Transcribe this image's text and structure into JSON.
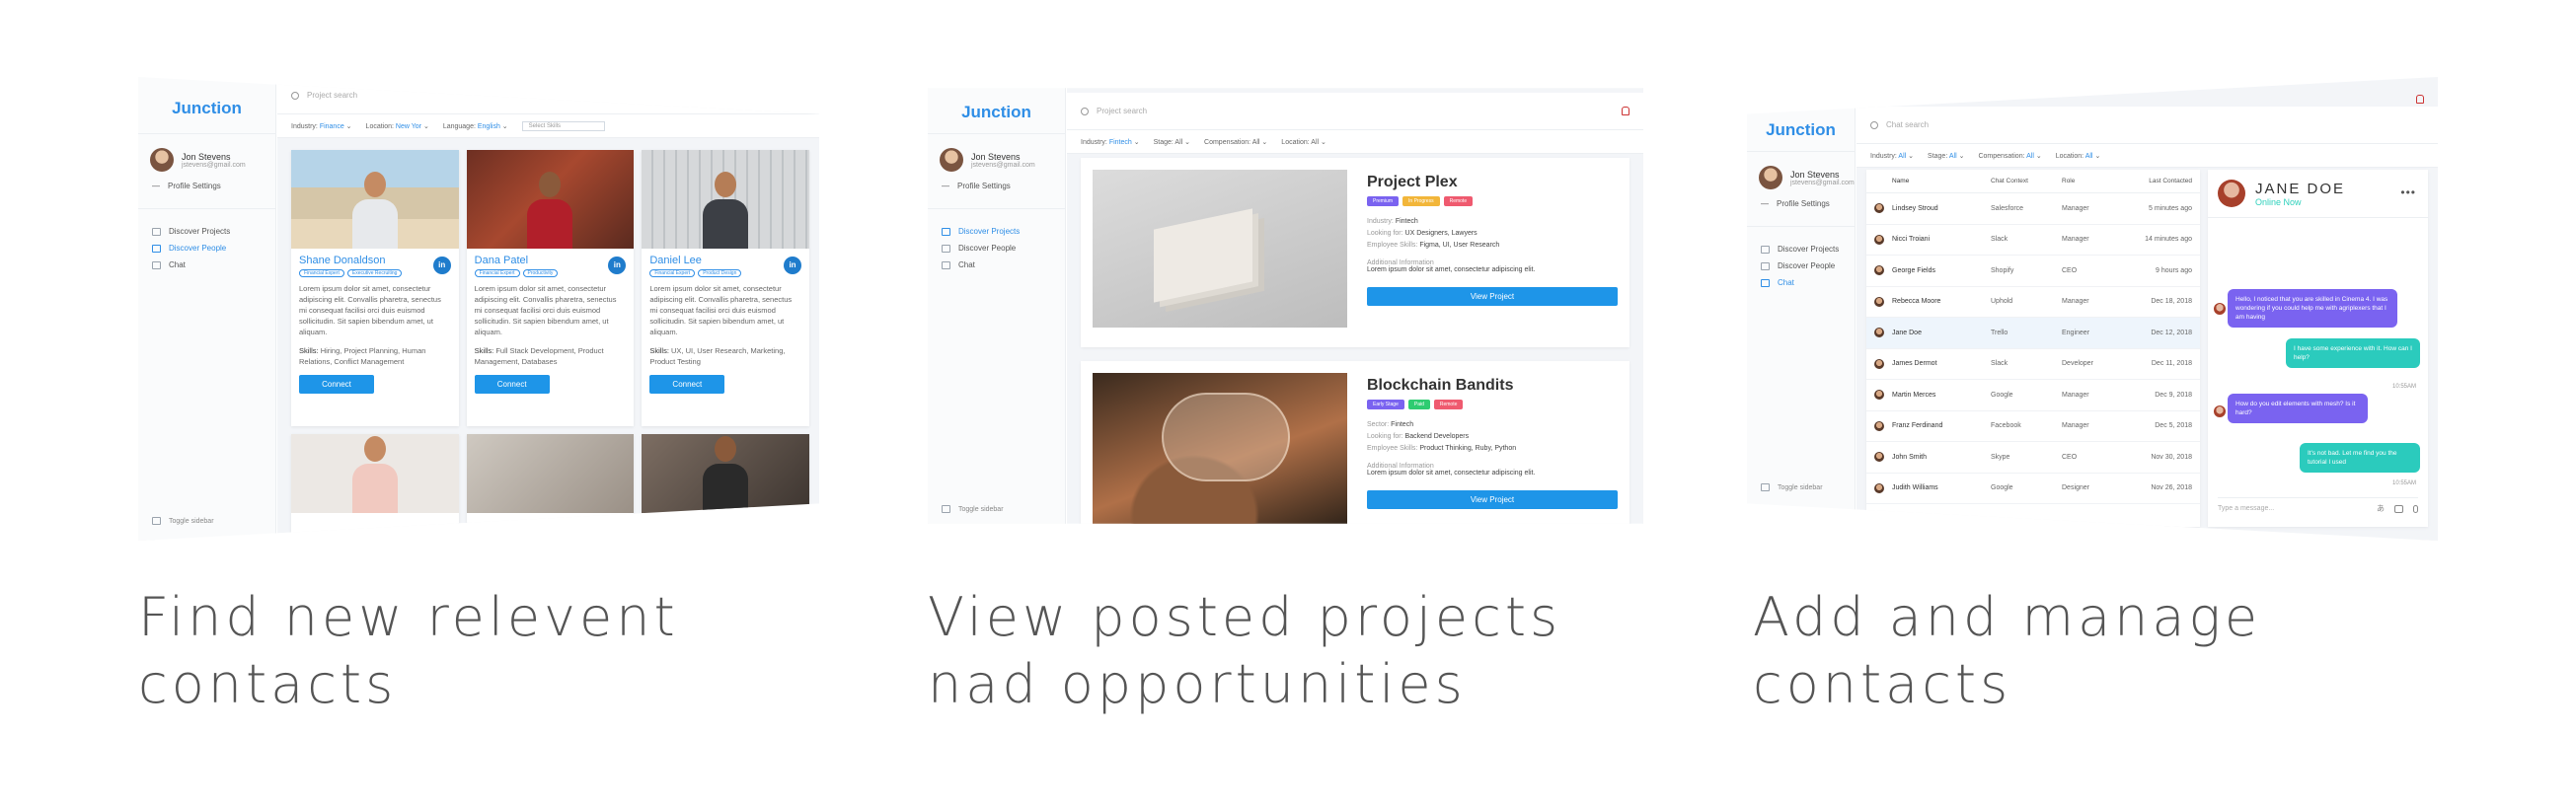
{
  "app": {
    "logo": "Junction"
  },
  "user": {
    "name": "Jon Stevens",
    "email": "jstevens@gmail.com"
  },
  "sidebar": {
    "profile_settings": "Profile Settings",
    "items": [
      "Discover Projects",
      "Discover People",
      "Chat"
    ],
    "toggle": "Toggle sidebar"
  },
  "search": {
    "placeholder": "Project search",
    "placeholder_chat": "Chat search"
  },
  "people_screen": {
    "filters": [
      {
        "label": "Industry:",
        "value": "Finance"
      },
      {
        "label": "Location:",
        "value": "New Yor"
      },
      {
        "label": "Language:",
        "value": "English"
      }
    ],
    "skills_select": "Select Skills",
    "cards": [
      {
        "name": "Shane Donaldson",
        "tags": [
          "Financial Expert",
          "Executive Recruiting"
        ],
        "bio": "Lorem ipsum dolor sit amet, consectetur adipiscing elit. Convallis pharetra, senectus mi consequat facilisi orci duis euismod sollicitudin. Sit sapien bibendum amet, ut aliquam.",
        "skills_label": "Skills:",
        "skills": "Hiring, Project Planning, Human Relations, Conflict Management",
        "button": "Connect",
        "linkedin": "in"
      },
      {
        "name": "Dana Patel",
        "tags": [
          "Financial Expert",
          "Productivity"
        ],
        "bio": "Lorem ipsum dolor sit amet, consectetur adipiscing elit. Convallis pharetra, senectus mi consequat facilisi orci duis euismod sollicitudin. Sit sapien bibendum amet, ut aliquam.",
        "skills_label": "Skills:",
        "skills": "Full Stack Development, Product Management, Databases",
        "button": "Connect",
        "linkedin": "in"
      },
      {
        "name": "Daniel Lee",
        "tags": [
          "Financial Expert",
          "Product Design"
        ],
        "bio": "Lorem ipsum dolor sit amet, consectetur adipiscing elit. Convallis pharetra, senectus mi consequat facilisi orci duis euismod sollicitudin. Sit sapien bibendum amet, ut aliquam.",
        "skills_label": "Skills:",
        "skills": "UX, UI, User Research, Marketing, Product Testing",
        "button": "Connect",
        "linkedin": "in"
      }
    ]
  },
  "projects_screen": {
    "filters": [
      {
        "label": "Industry:",
        "value": "Fintech"
      },
      {
        "label": "Stage:",
        "value": "All"
      },
      {
        "label": "Compensation:",
        "value": "All"
      },
      {
        "label": "Location:",
        "value": "All"
      }
    ],
    "projects": [
      {
        "title": "Project Plex",
        "tags": [
          {
            "text": "Premium",
            "color": "#7a63f0"
          },
          {
            "text": "In Progress",
            "color": "#f2b63a"
          },
          {
            "text": "Remote",
            "color": "#ef5a6f"
          }
        ],
        "meta": [
          {
            "label": "Industry:",
            "value": "Fintech"
          },
          {
            "label": "Looking for:",
            "value": "UX Designers, Lawyers"
          },
          {
            "label": "Employee Skills:",
            "value": "Figma, UI, User Research"
          }
        ],
        "additional_label": "Additional Information",
        "additional": "Lorem ipsum dolor sit amet, consectetur adipiscing elit.",
        "button": "View Project"
      },
      {
        "title": "Blockchain Bandits",
        "tags": [
          {
            "text": "Early Stage",
            "color": "#7a63f0"
          },
          {
            "text": "Paid",
            "color": "#2ecc71"
          },
          {
            "text": "Remote",
            "color": "#ef5a6f"
          }
        ],
        "meta": [
          {
            "label": "Sector:",
            "value": "Fintech"
          },
          {
            "label": "Looking for:",
            "value": "Backend Developers"
          },
          {
            "label": "Employee Skills:",
            "value": "Product Thinking, Ruby, Python"
          }
        ],
        "additional_label": "Additional Information",
        "additional": "Lorem ipsum dolor sit amet, consectetur adipiscing elit.",
        "button": "View Project"
      }
    ]
  },
  "contacts_screen": {
    "filters": [
      {
        "label": "Industry:",
        "value": "All"
      },
      {
        "label": "Stage:",
        "value": "All"
      },
      {
        "label": "Compensation:",
        "value": "All"
      },
      {
        "label": "Location:",
        "value": "All"
      }
    ],
    "columns": [
      "Name",
      "Chat Context",
      "Role",
      "Last Contacted"
    ],
    "rows": [
      [
        "Lindsey Stroud",
        "Salesforce",
        "Manager",
        "5 minutes ago"
      ],
      [
        "Nicci Troiani",
        "Slack",
        "Manager",
        "14 minutes ago"
      ],
      [
        "George Fields",
        "Shopify",
        "CEO",
        "9 hours ago"
      ],
      [
        "Rebecca Moore",
        "Uphold",
        "Manager",
        "Dec 18, 2018"
      ],
      [
        "Jane Doe",
        "Trello",
        "Engineer",
        "Dec 12, 2018"
      ],
      [
        "James Dermot",
        "Slack",
        "Developer",
        "Dec 11, 2018"
      ],
      [
        "Martin Merces",
        "Google",
        "Manager",
        "Dec 9, 2018"
      ],
      [
        "Franz Ferdinand",
        "Facebook",
        "Manager",
        "Dec 5, 2018"
      ],
      [
        "John Smith",
        "Skype",
        "CEO",
        "Nov 30, 2018"
      ],
      [
        "Judith Williams",
        "Google",
        "Designer",
        "Nov 26, 2018"
      ]
    ],
    "selected_row": 4,
    "chat": {
      "name": "JANE DOE",
      "status": "Online Now",
      "messages": [
        "Hello, I noticed that you are skilled in Cinema 4. I was wondering if you could help me with agriplexers that I am having",
        "I have some experience with it. How can I help?",
        "How do you edit elements with mesh? Is it hard?",
        "It's not bad. Let me find you the tutorial I used"
      ],
      "timestamps": [
        "10:55AM",
        "10:55AM"
      ],
      "input_placeholder": "Type a message..."
    }
  },
  "captions": [
    "Find new relevent contacts",
    "View posted projects nad opportunities",
    "Add and manage contacts"
  ],
  "colors": {
    "accent": "#1e95e8",
    "logo": "#2f8ee6",
    "chat_left": "#7a63f0",
    "chat_right": "#2bcbbd"
  }
}
